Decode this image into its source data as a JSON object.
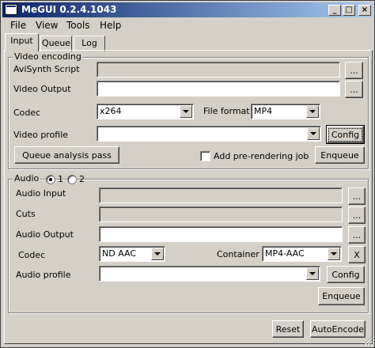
{
  "window": {
    "title": "MeGUI 0.2.4.1043",
    "minimize": "_",
    "maximize": "□",
    "close": "×"
  },
  "menu": [
    "File",
    "View",
    "Tools",
    "Help"
  ],
  "tabs": [
    "Input",
    "Queue",
    "Log"
  ],
  "video": {
    "legend": "Video encoding",
    "avisynth_label": "AviSynth Script",
    "avisynth_value": "",
    "output_label": "Video Output",
    "output_value": "",
    "codec_label": "Codec",
    "codec_value": "x264",
    "format_label": "File format",
    "format_value": "MP4",
    "profile_label": "Video profile",
    "profile_value": "",
    "browse": "...",
    "config": "Config",
    "queue_analysis": "Queue analysis pass",
    "add_prerendering": "Add pre-rendering job",
    "enqueue": "Enqueue"
  },
  "audio": {
    "legend": "Audio",
    "radio1": "1",
    "radio2": "2",
    "input_label": "Audio Input",
    "input_value": "",
    "cuts_label": "Cuts",
    "cuts_value": "",
    "output_label": "Audio Output",
    "output_value": "",
    "codec_label": "Codec",
    "codec_value": "ND AAC",
    "container_label": "Container",
    "container_value": "MP4-AAC",
    "clear": "X",
    "profile_label": "Audio profile",
    "profile_value": "",
    "browse": "...",
    "config": "Config",
    "enqueue": "Enqueue"
  },
  "footer": {
    "reset": "Reset",
    "autoencode": "AutoEncode"
  }
}
